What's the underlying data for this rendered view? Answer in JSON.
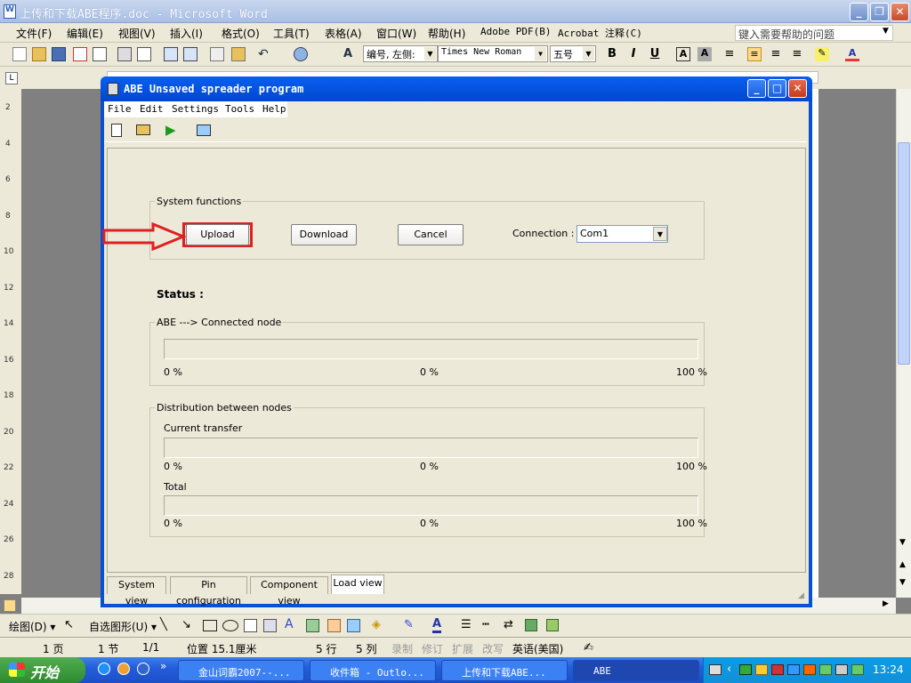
{
  "word": {
    "title": "上传和下载ABE程序.doc - Microsoft Word",
    "menu": [
      "文件(F)",
      "编辑(E)",
      "视图(V)",
      "插入(I)",
      "格式(O)",
      "工具(T)",
      "表格(A)",
      "窗口(W)",
      "帮助(H)",
      "Adobe PDF(B)",
      "Acrobat 注释(C)"
    ],
    "help_placeholder": "键入需要帮助的问题",
    "style_box": "编号, 左侧:",
    "font_box": "Times New Roman",
    "size_box": "五号",
    "ruler_numbers": [
      "2",
      "4",
      "6",
      "8",
      "10",
      "12",
      "14",
      "16",
      "18",
      "20",
      "22",
      "24",
      "26",
      "28"
    ],
    "draw_label": "绘图(D) ▾",
    "autoshape_label": "自选图形(U) ▾",
    "status": {
      "page": "1 页",
      "section": "1 节",
      "pages": "1/1",
      "position": "位置 15.1厘米",
      "line": "5 行",
      "column": "5 列",
      "rec": "录制",
      "trk": "修订",
      "ext": "扩展",
      "ovr": "改写",
      "lang": "英语(美国)"
    }
  },
  "abe": {
    "title": "ABE Unsaved spreader program",
    "menu": [
      "File",
      "Edit",
      "Settings",
      "Tools",
      "Help"
    ],
    "system_functions_label": "System functions",
    "upload": "Upload",
    "download": "Download",
    "cancel": "Cancel",
    "connection_label": "Connection :",
    "connection_value": "Com1",
    "status_label": "Status :",
    "connected_group": "ABE ---> Connected node",
    "connected_progress": 0,
    "distribution_group": "Distribution between nodes",
    "current_transfer_label": "Current transfer",
    "current_progress": 0,
    "total_label": "Total",
    "total_progress": 0,
    "pct_start": "0 %",
    "pct_mid": "0 %",
    "pct_end": "100 %",
    "tabs": [
      "System view",
      "Pin configuration",
      "Component view",
      "Load view"
    ],
    "active_tab": "Load view"
  },
  "taskbar": {
    "start": "开始",
    "tasks": [
      "金山词霸2007--...",
      "收件箱 - Outlo...",
      "上传和下载ABE...",
      "ABE"
    ],
    "clock": "13:24"
  },
  "colors": {
    "highlight_red": "#e02020",
    "xp_blue": "#0a50d6",
    "face": "#ece9d8"
  }
}
